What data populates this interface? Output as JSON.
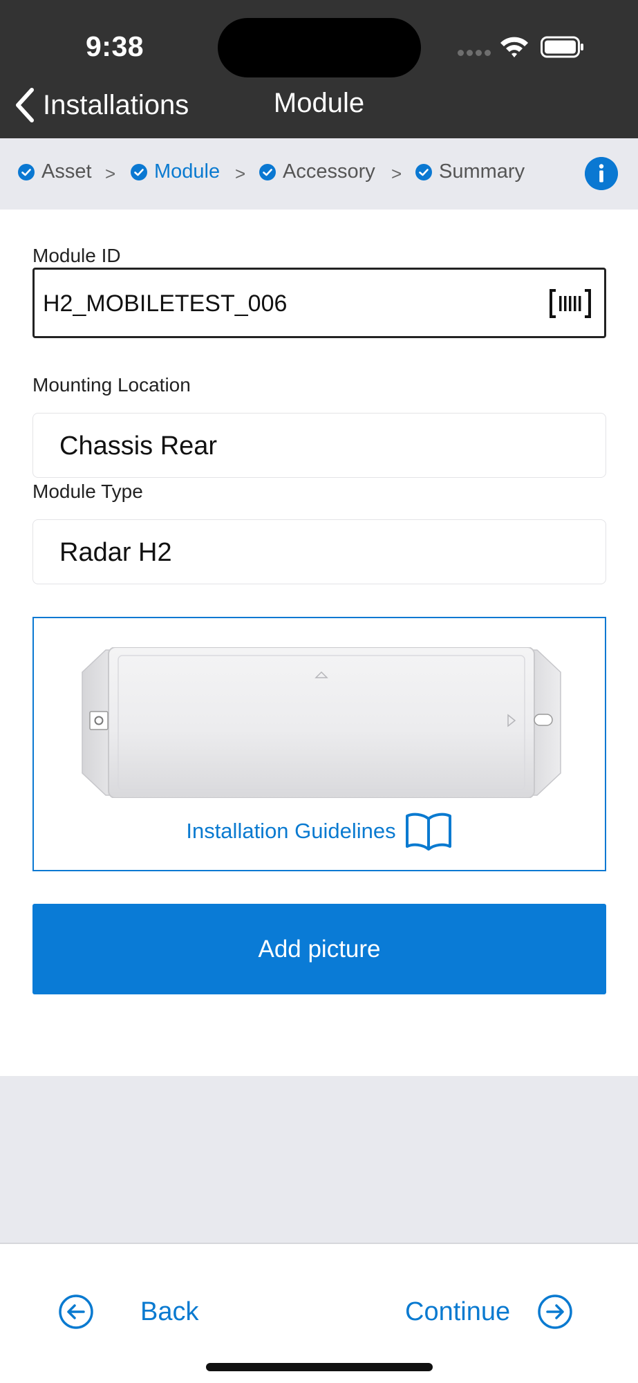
{
  "status_bar": {
    "time": "9:38"
  },
  "nav": {
    "back_label": "Installations",
    "title": "Module"
  },
  "stepper": {
    "steps": [
      {
        "label": "Asset",
        "active": false
      },
      {
        "label": "Module",
        "active": true
      },
      {
        "label": "Accessory",
        "active": false
      },
      {
        "label": "Summary",
        "active": false
      }
    ],
    "separator": ">"
  },
  "form": {
    "module_id": {
      "label": "Module ID",
      "value": "H2_MOBILETEST_006"
    },
    "mounting_location": {
      "label": "Mounting Location",
      "value": "Chassis Rear"
    },
    "module_type": {
      "label": "Module Type",
      "value": "Radar H2"
    },
    "guidelines_label": "Installation Guidelines",
    "add_picture_label": "Add picture"
  },
  "footer": {
    "back_label": "Back",
    "continue_label": "Continue"
  },
  "colors": {
    "accent": "#0a7ad0",
    "topbar": "#333333",
    "stepper_bg": "#e8e9ee"
  }
}
